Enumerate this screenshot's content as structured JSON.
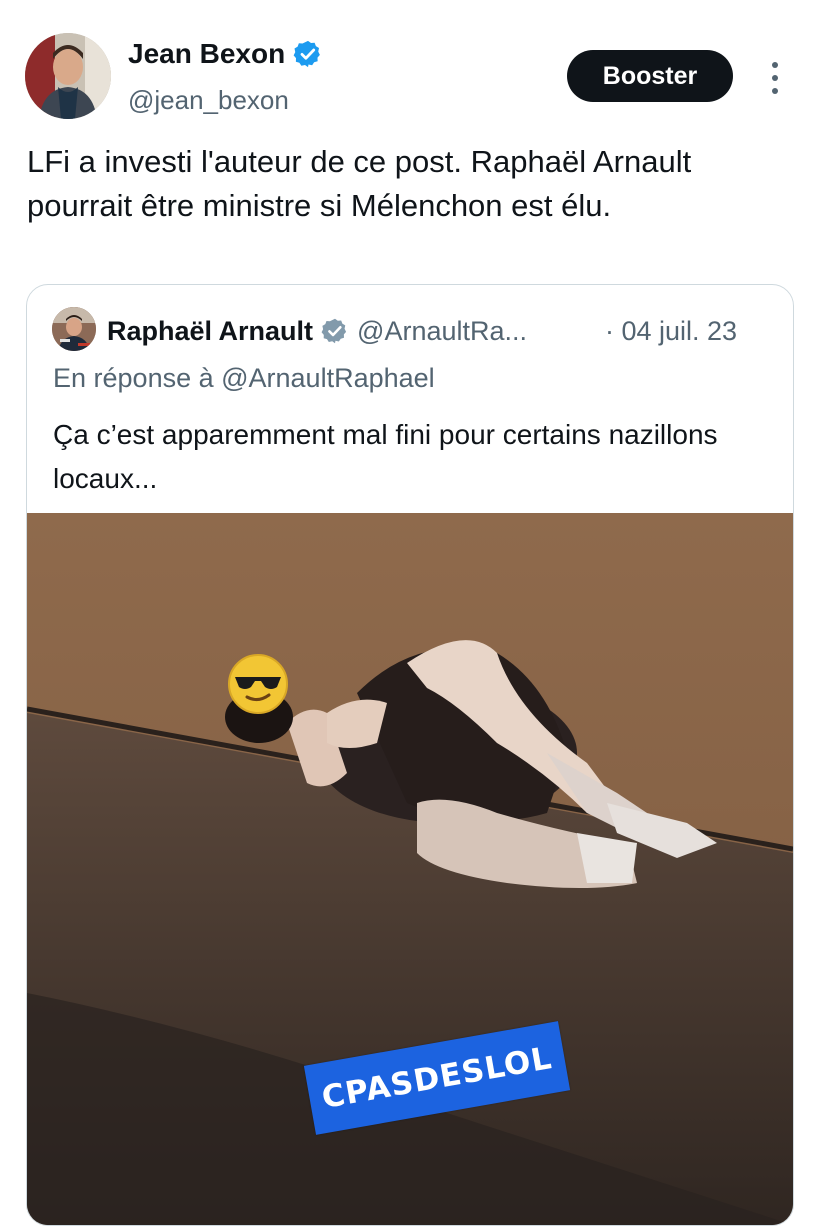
{
  "post": {
    "author": {
      "name": "Jean Bexon",
      "handle": "@jean_bexon",
      "verified": true
    },
    "booster_label": "Booster",
    "text": "LFi a investi l'auteur de ce post. Raphaël Arnault pourrait être ministre si Mélenchon est élu."
  },
  "quoted": {
    "author": {
      "name": "Raphaël Arnault",
      "handle": "@ArnaultRa...",
      "verified": true
    },
    "date": "· 04 juil. 23",
    "reply_to": "En réponse à @ArnaultRaphael",
    "text": "Ça c’est apparemment mal fini pour certains nazillons locaux...",
    "media": {
      "watermark": "CPASDESLOL",
      "emoji_face": "sunglasses-face-icon"
    }
  },
  "colors": {
    "verified_blue": "#1d9bf0",
    "quoted_verified_gray": "#829aab",
    "booster_bg": "#0f1419",
    "secondary_text": "#536471",
    "watermark_bg": "#1c63e0"
  }
}
